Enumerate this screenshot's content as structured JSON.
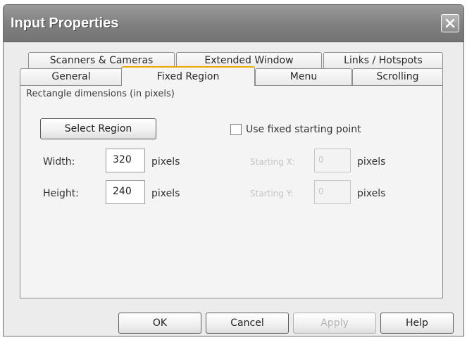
{
  "window": {
    "title": "Input Properties"
  },
  "tabs": {
    "row1": [
      "Scanners & Cameras",
      "Extended Window",
      "Links / Hotspots"
    ],
    "row2": [
      "General",
      "Fixed Region",
      "Menu",
      "Scrolling"
    ],
    "active": "Fixed Region"
  },
  "fixed_region": {
    "group_label": "Rectangle dimensions (in pixels)",
    "select_region_label": "Select Region",
    "use_fixed_start_label": "Use fixed starting point",
    "use_fixed_start_checked": false,
    "width_label": "Width:",
    "width_value": "320",
    "width_unit": "pixels",
    "height_label": "Height:",
    "height_value": "240",
    "height_unit": "pixels",
    "start_x_label": "Starting X:",
    "start_x_value": "0",
    "start_x_unit": "pixels",
    "start_y_label": "Starting Y:",
    "start_y_value": "0",
    "start_y_unit": "pixels"
  },
  "footer": {
    "ok_label": "OK",
    "cancel_label": "Cancel",
    "apply_label": "Apply",
    "help_label": "Help"
  }
}
